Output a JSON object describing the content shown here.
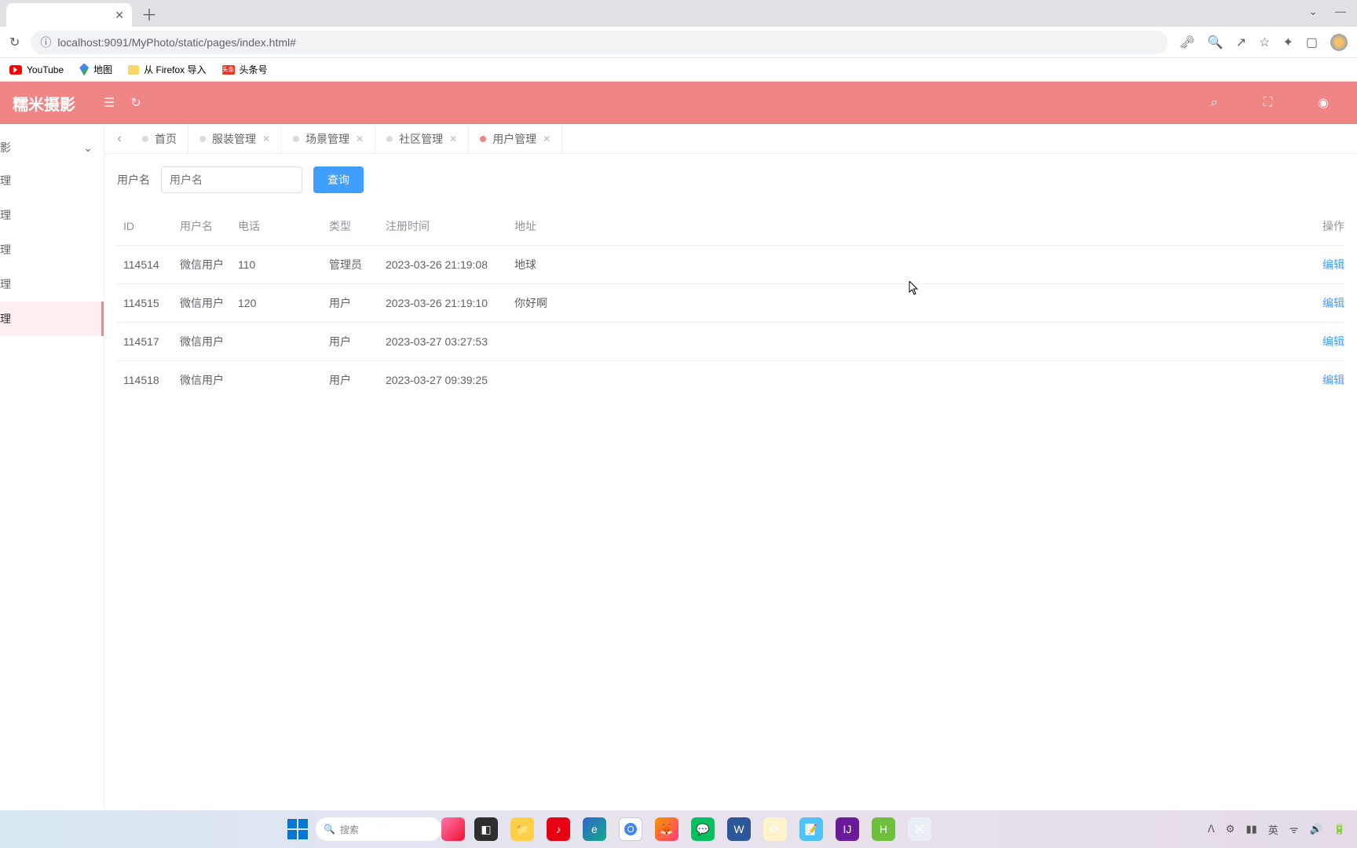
{
  "browser": {
    "url": "localhost:9091/MyPhoto/static/pages/index.html#",
    "bookmarks": {
      "youtube": "YouTube",
      "maps": "地图",
      "firefox_import": "从 Firefox 导入",
      "toutiao": "头条号",
      "toutiao_icon": "头条"
    }
  },
  "app": {
    "logo": "糯米摄影",
    "sidebar": {
      "header": "影",
      "items": [
        "理",
        "理",
        "理",
        "理",
        "理"
      ]
    },
    "tabs": {
      "items": [
        {
          "label": "首页",
          "closable": false,
          "active": false
        },
        {
          "label": "服装管理",
          "closable": true,
          "active": false
        },
        {
          "label": "场景管理",
          "closable": true,
          "active": false
        },
        {
          "label": "社区管理",
          "closable": true,
          "active": false
        },
        {
          "label": "用户管理",
          "closable": true,
          "active": true
        }
      ]
    },
    "filter": {
      "label": "用户名",
      "placeholder": "用户名",
      "button": "查询"
    },
    "table": {
      "headers": {
        "id": "ID",
        "username": "用户名",
        "phone": "电话",
        "type": "类型",
        "regtime": "注册时间",
        "address": "地址",
        "op": "操作"
      },
      "rows": [
        {
          "id": "114514",
          "username": "微信用户",
          "phone": "110",
          "type": "管理员",
          "regtime": "2023-03-26 21:19:08",
          "address": "地球",
          "op": "编辑"
        },
        {
          "id": "114515",
          "username": "微信用户",
          "phone": "120",
          "type": "用户",
          "regtime": "2023-03-26 21:19:10",
          "address": "你好啊",
          "op": "编辑"
        },
        {
          "id": "114517",
          "username": "微信用户",
          "phone": "",
          "type": "用户",
          "regtime": "2023-03-27 03:27:53",
          "address": "",
          "op": "编辑"
        },
        {
          "id": "114518",
          "username": "微信用户",
          "phone": "",
          "type": "用户",
          "regtime": "2023-03-27 09:39:25",
          "address": "",
          "op": "编辑"
        }
      ]
    }
  },
  "taskbar": {
    "search": "搜索",
    "ime": "英"
  }
}
